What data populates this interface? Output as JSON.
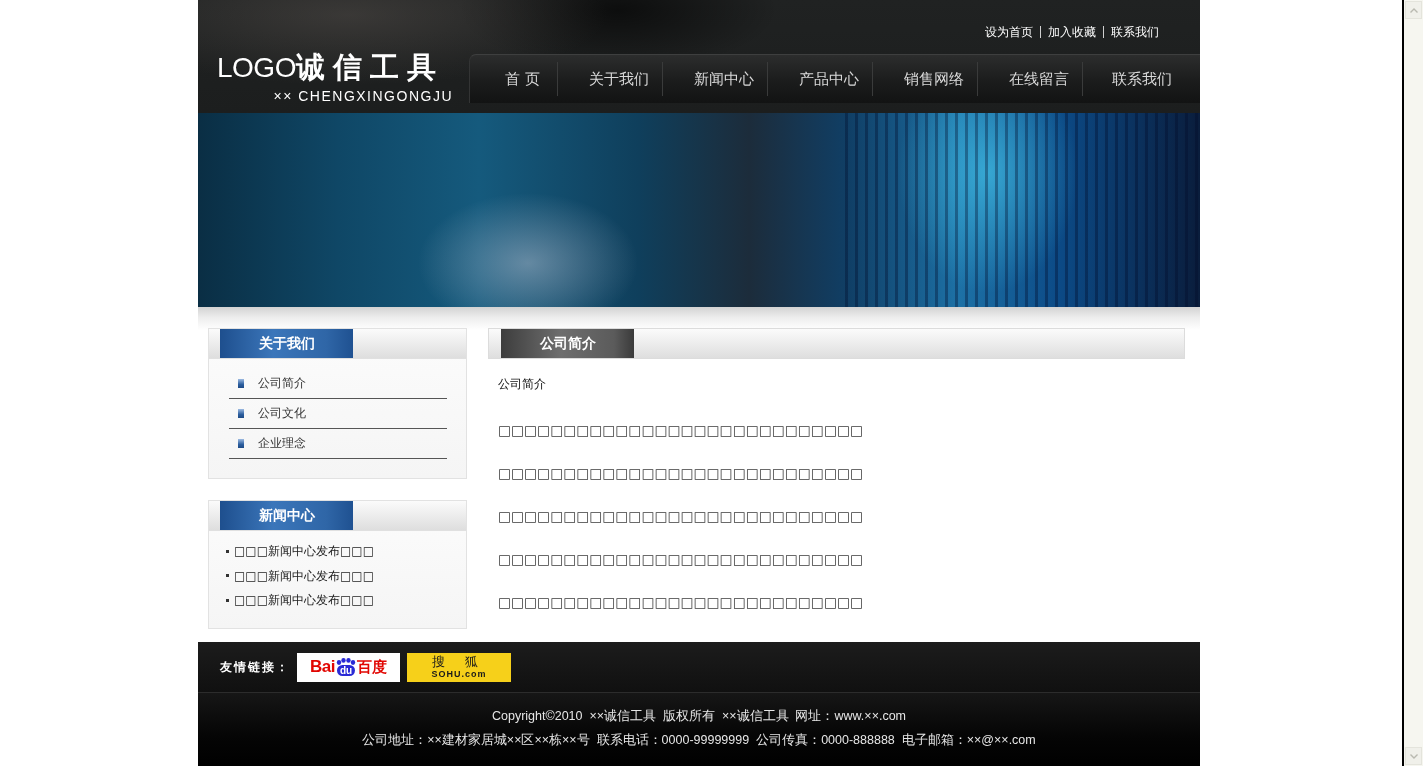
{
  "header": {
    "top_links": [
      "设为首页",
      "加入收藏",
      "联系我们"
    ],
    "logo": {
      "title": "LOGO**诚信工具**",
      "subtitle": "×× CHENGXINGONGJU"
    },
    "nav": [
      "首 页",
      "关于我们",
      "新闻中心",
      "产品中心",
      "销售网络",
      "在线留言",
      "联系我们"
    ]
  },
  "sidebar": [
    {
      "title": "关于我们",
      "kind": "links",
      "items": [
        "公司简介",
        "公司文化",
        "企业理念"
      ]
    },
    {
      "title": "新闻中心",
      "kind": "news",
      "items": [
        "□□□新闻中心发布□□□",
        "□□□新闻中心发布□□□",
        "□□□新闻中心发布□□□"
      ]
    }
  ],
  "main": {
    "title": "公司简介",
    "heading": "公司简介",
    "paragraphs": [
      "□□□□□□□□□□□□□□□□□□□□□□□□□□□□",
      "□□□□□□□□□□□□□□□□□□□□□□□□□□□□",
      "□□□□□□□□□□□□□□□□□□□□□□□□□□□□",
      "□□□□□□□□□□□□□□□□□□□□□□□□□□□□",
      "□□□□□□□□□□□□□□□□□□□□□□□□□□□□"
    ]
  },
  "footer": {
    "links_label": "友情链接：",
    "friend_links": [
      {
        "kind": "baidu",
        "parts": [
          "Bai",
          "du",
          "百度"
        ]
      },
      {
        "kind": "sohu",
        "parts": [
          "搜 狐",
          "SOHU.com"
        ]
      }
    ],
    "lines": [
      "Copyright©2010  ××诚信工具  版权所有  ××诚信工具  网址：www.××.com",
      "公司地址：××建材家居城××区××栋××号  联系电话：0000-99999999  公司传真：0000-888888  电子邮箱：××@××.com"
    ]
  }
}
